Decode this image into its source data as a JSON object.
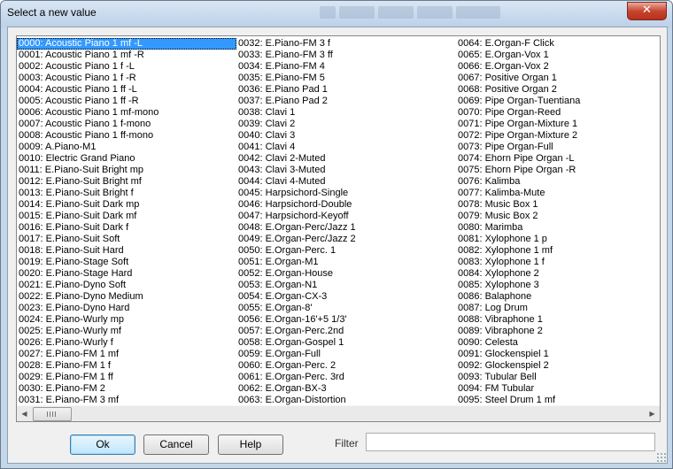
{
  "window": {
    "title": "Select a new value",
    "close_label": "✕"
  },
  "list": {
    "selected_index": 0,
    "columns": [
      [
        "0000: Acoustic Piano 1 mf -L",
        "0001: Acoustic Piano 1 mf -R",
        "0002: Acoustic Piano 1  f -L",
        "0003: Acoustic Piano 1  f -R",
        "0004: Acoustic Piano 1 ff -L",
        "0005: Acoustic Piano 1 ff -R",
        "0006: Acoustic Piano 1 mf-mono",
        "0007: Acoustic Piano 1  f-mono",
        "0008: Acoustic Piano 1 ff-mono",
        "0009: A.Piano-M1",
        "0010: Electric Grand Piano",
        "0011: E.Piano-Suit Bright mp",
        "0012: E.Piano-Suit Bright mf",
        "0013: E.Piano-Suit Bright  f",
        "0014: E.Piano-Suit Dark mp",
        "0015: E.Piano-Suit Dark mf",
        "0016: E.Piano-Suit Dark  f",
        "0017: E.Piano-Suit Soft",
        "0018: E.Piano-Suit Hard",
        "0019: E.Piano-Stage Soft",
        "0020: E.Piano-Stage Hard",
        "0021: E.Piano-Dyno Soft",
        "0022: E.Piano-Dyno Medium",
        "0023: E.Piano-Dyno Hard",
        "0024: E.Piano-Wurly mp",
        "0025: E.Piano-Wurly mf",
        "0026: E.Piano-Wurly  f",
        "0027: E.Piano-FM 1 mf",
        "0028: E.Piano-FM 1  f",
        "0029: E.Piano-FM 1 ff",
        "0030: E.Piano-FM 2",
        "0031: E.Piano-FM 3 mf"
      ],
      [
        "0032: E.Piano-FM 3  f",
        "0033: E.Piano-FM 3 ff",
        "0034: E.Piano-FM 4",
        "0035: E.Piano-FM 5",
        "0036: E.Piano Pad 1",
        "0037: E.Piano Pad 2",
        "0038: Clavi 1",
        "0039: Clavi 2",
        "0040: Clavi 3",
        "0041: Clavi 4",
        "0042: Clavi 2-Muted",
        "0043: Clavi 3-Muted",
        "0044: Clavi 4-Muted",
        "0045: Harpsichord-Single",
        "0046: Harpsichord-Double",
        "0047: Harpsichord-Keyoff",
        "0048: E.Organ-Perc/Jazz 1",
        "0049: E.Organ-Perc/Jazz 2",
        "0050: E.Organ-Perc. 1",
        "0051: E.Organ-M1",
        "0052: E.Organ-House",
        "0053: E.Organ-N1",
        "0054: E.Organ-CX-3",
        "0055: E.Organ-8'",
        "0056: E.Organ-16'+5 1/3'",
        "0057: E.Organ-Perc.2nd",
        "0058: E.Organ-Gospel 1",
        "0059: E.Organ-Full",
        "0060: E.Organ-Perc. 2",
        "0061: E.Organ-Perc. 3rd",
        "0062: E.Organ-BX-3",
        "0063: E.Organ-Distortion"
      ],
      [
        "0064: E.Organ-F Click",
        "0065: E.Organ-Vox 1",
        "0066: E.Organ-Vox 2",
        "0067: Positive Organ 1",
        "0068: Positive Organ 2",
        "0069: Pipe Organ-Tuentiana",
        "0070: Pipe Organ-Reed",
        "0071: Pipe Organ-Mixture 1",
        "0072: Pipe Organ-Mixture 2",
        "0073: Pipe Organ-Full",
        "0074: Ehorn Pipe Organ -L",
        "0075: Ehorn Pipe Organ -R",
        "0076: Kalimba",
        "0077: Kalimba-Mute",
        "0078: Music Box 1",
        "0079: Music Box 2",
        "0080: Marimba",
        "0081: Xylophone 1  p",
        "0082: Xylophone 1 mf",
        "0083: Xylophone 1  f",
        "0084: Xylophone 2",
        "0085: Xylophone 3",
        "0086: Balaphone",
        "0087: Log Drum",
        "0088: Vibraphone 1",
        "0089: Vibraphone 2",
        "0090: Celesta",
        "0091: Glockenspiel 1",
        "0092: Glockenspiel 2",
        "0093: Tubular Bell",
        "0094: FM Tubular",
        "0095: Steel Drum 1 mf"
      ]
    ]
  },
  "scrollbar": {
    "left_arrow": "◀",
    "right_arrow": "▶"
  },
  "buttons": {
    "ok": "Ok",
    "cancel": "Cancel",
    "help": "Help"
  },
  "filter": {
    "label": "Filter",
    "value": ""
  }
}
